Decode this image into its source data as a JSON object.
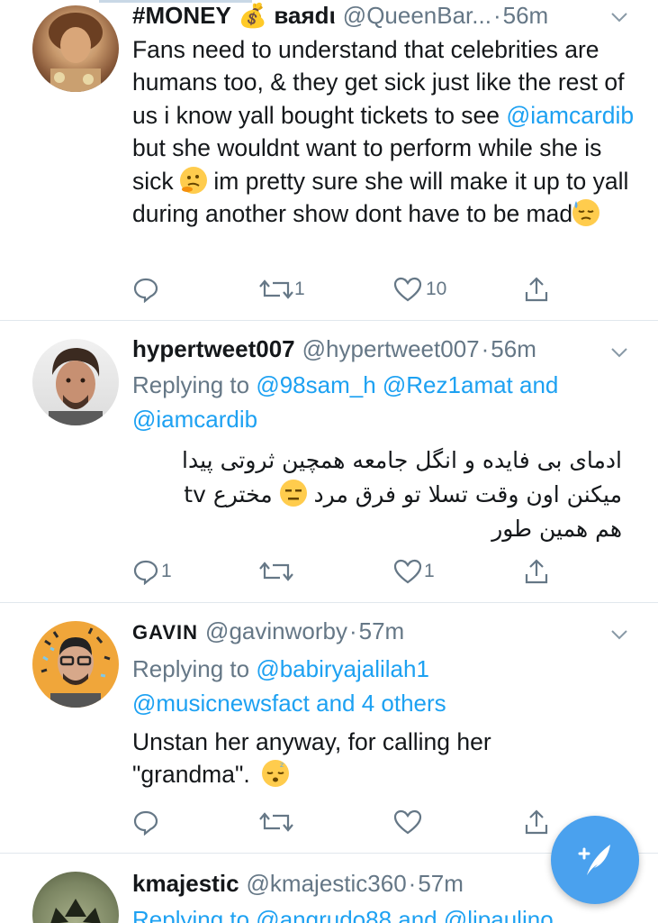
{
  "tweets": [
    {
      "display_name": "#MONEY",
      "name_badge": "💰 ваяdι",
      "handle": "@QueenBar...",
      "time": "56m",
      "text_parts": [
        "Fans need to understand that celebrities are humans too, & they get sick just like the rest of us i know yall bought tickets to see ",
        "@iamcardib",
        " but she wouldnt want to perform while she is sick",
        "im pretty sure she will make it up to yall during another show dont have to be mad"
      ],
      "reply_count": "",
      "retweet_count": "1",
      "like_count": "10"
    },
    {
      "display_name": "hypertweet007",
      "handle": "@hypertweet007",
      "time": "56m",
      "replying_label": "Replying to",
      "replying_mentions": "@98sam_h @Rez1amat and @iamcardib",
      "text_line1": "ادمای بی فایده و انگل جامعه همچین ثروتی پیدا",
      "text_line2": "میکنن اون وقت تسلا تو فرق مرد",
      "text_line2b": "مخترع tv",
      "text_line3": "هم همین طور",
      "reply_count": "1",
      "retweet_count": "",
      "like_count": "1"
    },
    {
      "display_name": "GAVIN",
      "handle": "@gavinworby",
      "time": "57m",
      "replying_label": "Replying to",
      "replying_mention1": "@babiryajalilah1",
      "replying_mention2": "@musicnewsfact and 4 others",
      "text": "Unstan her anyway, for calling her \"grandma\".",
      "reply_count": "",
      "retweet_count": "",
      "like_count": ""
    },
    {
      "display_name": "kmajestic",
      "handle": "@kmajestic360",
      "time": "57m",
      "replying_partial": "Replying to @angrudo88 and @lipaulino"
    }
  ],
  "colors": {
    "link": "#1da1f2",
    "secondary": "#657786",
    "fab": "#4aa1ee"
  },
  "fab_icon": "compose-tweet-icon"
}
